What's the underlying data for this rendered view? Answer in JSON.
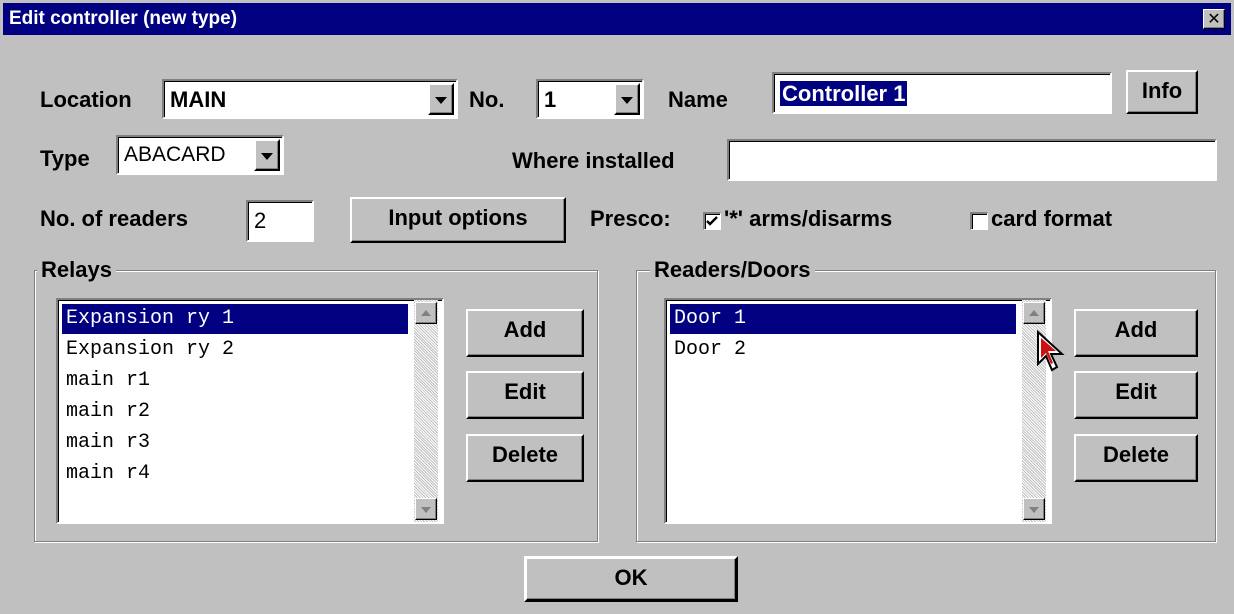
{
  "window": {
    "title": "Edit controller (new type)",
    "close_glyph": "✕"
  },
  "location": {
    "label": "Location",
    "value": "MAIN"
  },
  "number": {
    "label": "No.",
    "value": "1"
  },
  "name": {
    "label": "Name",
    "value": "Controller 1"
  },
  "info_button": "Info",
  "type": {
    "label": "Type",
    "value": "ABACARD"
  },
  "where_installed": {
    "label": "Where installed",
    "value": ""
  },
  "readers": {
    "label": "No. of readers",
    "value": "2"
  },
  "input_options_button": "Input options",
  "presco": {
    "label": "Presco:",
    "arms": {
      "label": "'*' arms/disarms",
      "checked": true
    },
    "card_format": {
      "label": "card format",
      "checked": false
    }
  },
  "relays": {
    "label": "Relays",
    "items": [
      "Expansion ry 1",
      "Expansion ry 2",
      "main r1",
      "main r2",
      "main r3",
      "main r4"
    ],
    "selected_index": 0,
    "add": "Add",
    "edit": "Edit",
    "delete": "Delete"
  },
  "doors": {
    "label": "Readers/Doors",
    "items": [
      "Door 1",
      "Door 2"
    ],
    "selected_index": 0,
    "add": "Add",
    "edit": "Edit",
    "delete": "Delete"
  },
  "ok_button": "OK",
  "icons": {
    "dropdown": "chevron-down-icon",
    "checkmark": "check-icon",
    "cursor": "mouse-pointer-icon"
  },
  "colors": {
    "face": "#c0c0c0",
    "titlebar": "#000080",
    "selection": "#000080"
  }
}
